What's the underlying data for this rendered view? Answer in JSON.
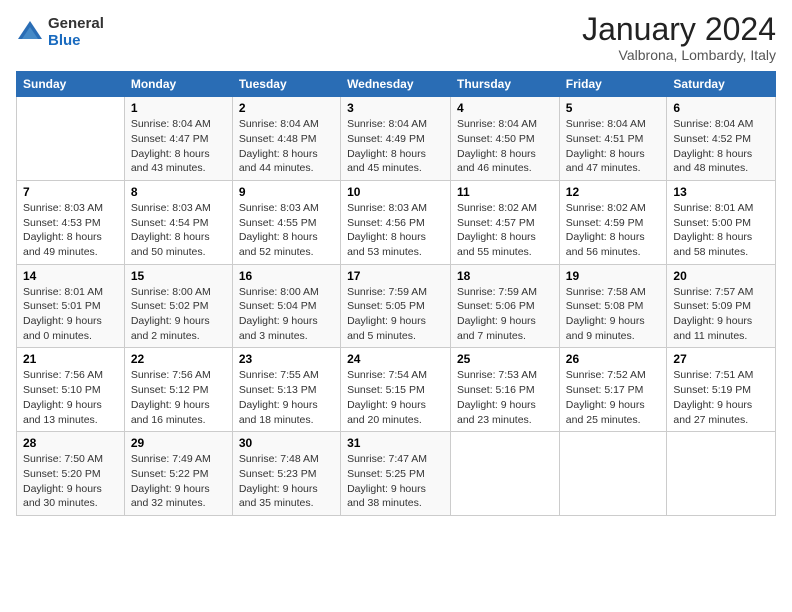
{
  "header": {
    "logo_general": "General",
    "logo_blue": "Blue",
    "month_year": "January 2024",
    "location": "Valbrona, Lombardy, Italy"
  },
  "days_of_week": [
    "Sunday",
    "Monday",
    "Tuesday",
    "Wednesday",
    "Thursday",
    "Friday",
    "Saturday"
  ],
  "weeks": [
    [
      {
        "day": "",
        "sunrise": "",
        "sunset": "",
        "daylight": ""
      },
      {
        "day": "1",
        "sunrise": "Sunrise: 8:04 AM",
        "sunset": "Sunset: 4:47 PM",
        "daylight": "Daylight: 8 hours and 43 minutes."
      },
      {
        "day": "2",
        "sunrise": "Sunrise: 8:04 AM",
        "sunset": "Sunset: 4:48 PM",
        "daylight": "Daylight: 8 hours and 44 minutes."
      },
      {
        "day": "3",
        "sunrise": "Sunrise: 8:04 AM",
        "sunset": "Sunset: 4:49 PM",
        "daylight": "Daylight: 8 hours and 45 minutes."
      },
      {
        "day": "4",
        "sunrise": "Sunrise: 8:04 AM",
        "sunset": "Sunset: 4:50 PM",
        "daylight": "Daylight: 8 hours and 46 minutes."
      },
      {
        "day": "5",
        "sunrise": "Sunrise: 8:04 AM",
        "sunset": "Sunset: 4:51 PM",
        "daylight": "Daylight: 8 hours and 47 minutes."
      },
      {
        "day": "6",
        "sunrise": "Sunrise: 8:04 AM",
        "sunset": "Sunset: 4:52 PM",
        "daylight": "Daylight: 8 hours and 48 minutes."
      }
    ],
    [
      {
        "day": "7",
        "sunrise": "Sunrise: 8:03 AM",
        "sunset": "Sunset: 4:53 PM",
        "daylight": "Daylight: 8 hours and 49 minutes."
      },
      {
        "day": "8",
        "sunrise": "Sunrise: 8:03 AM",
        "sunset": "Sunset: 4:54 PM",
        "daylight": "Daylight: 8 hours and 50 minutes."
      },
      {
        "day": "9",
        "sunrise": "Sunrise: 8:03 AM",
        "sunset": "Sunset: 4:55 PM",
        "daylight": "Daylight: 8 hours and 52 minutes."
      },
      {
        "day": "10",
        "sunrise": "Sunrise: 8:03 AM",
        "sunset": "Sunset: 4:56 PM",
        "daylight": "Daylight: 8 hours and 53 minutes."
      },
      {
        "day": "11",
        "sunrise": "Sunrise: 8:02 AM",
        "sunset": "Sunset: 4:57 PM",
        "daylight": "Daylight: 8 hours and 55 minutes."
      },
      {
        "day": "12",
        "sunrise": "Sunrise: 8:02 AM",
        "sunset": "Sunset: 4:59 PM",
        "daylight": "Daylight: 8 hours and 56 minutes."
      },
      {
        "day": "13",
        "sunrise": "Sunrise: 8:01 AM",
        "sunset": "Sunset: 5:00 PM",
        "daylight": "Daylight: 8 hours and 58 minutes."
      }
    ],
    [
      {
        "day": "14",
        "sunrise": "Sunrise: 8:01 AM",
        "sunset": "Sunset: 5:01 PM",
        "daylight": "Daylight: 9 hours and 0 minutes."
      },
      {
        "day": "15",
        "sunrise": "Sunrise: 8:00 AM",
        "sunset": "Sunset: 5:02 PM",
        "daylight": "Daylight: 9 hours and 2 minutes."
      },
      {
        "day": "16",
        "sunrise": "Sunrise: 8:00 AM",
        "sunset": "Sunset: 5:04 PM",
        "daylight": "Daylight: 9 hours and 3 minutes."
      },
      {
        "day": "17",
        "sunrise": "Sunrise: 7:59 AM",
        "sunset": "Sunset: 5:05 PM",
        "daylight": "Daylight: 9 hours and 5 minutes."
      },
      {
        "day": "18",
        "sunrise": "Sunrise: 7:59 AM",
        "sunset": "Sunset: 5:06 PM",
        "daylight": "Daylight: 9 hours and 7 minutes."
      },
      {
        "day": "19",
        "sunrise": "Sunrise: 7:58 AM",
        "sunset": "Sunset: 5:08 PM",
        "daylight": "Daylight: 9 hours and 9 minutes."
      },
      {
        "day": "20",
        "sunrise": "Sunrise: 7:57 AM",
        "sunset": "Sunset: 5:09 PM",
        "daylight": "Daylight: 9 hours and 11 minutes."
      }
    ],
    [
      {
        "day": "21",
        "sunrise": "Sunrise: 7:56 AM",
        "sunset": "Sunset: 5:10 PM",
        "daylight": "Daylight: 9 hours and 13 minutes."
      },
      {
        "day": "22",
        "sunrise": "Sunrise: 7:56 AM",
        "sunset": "Sunset: 5:12 PM",
        "daylight": "Daylight: 9 hours and 16 minutes."
      },
      {
        "day": "23",
        "sunrise": "Sunrise: 7:55 AM",
        "sunset": "Sunset: 5:13 PM",
        "daylight": "Daylight: 9 hours and 18 minutes."
      },
      {
        "day": "24",
        "sunrise": "Sunrise: 7:54 AM",
        "sunset": "Sunset: 5:15 PM",
        "daylight": "Daylight: 9 hours and 20 minutes."
      },
      {
        "day": "25",
        "sunrise": "Sunrise: 7:53 AM",
        "sunset": "Sunset: 5:16 PM",
        "daylight": "Daylight: 9 hours and 23 minutes."
      },
      {
        "day": "26",
        "sunrise": "Sunrise: 7:52 AM",
        "sunset": "Sunset: 5:17 PM",
        "daylight": "Daylight: 9 hours and 25 minutes."
      },
      {
        "day": "27",
        "sunrise": "Sunrise: 7:51 AM",
        "sunset": "Sunset: 5:19 PM",
        "daylight": "Daylight: 9 hours and 27 minutes."
      }
    ],
    [
      {
        "day": "28",
        "sunrise": "Sunrise: 7:50 AM",
        "sunset": "Sunset: 5:20 PM",
        "daylight": "Daylight: 9 hours and 30 minutes."
      },
      {
        "day": "29",
        "sunrise": "Sunrise: 7:49 AM",
        "sunset": "Sunset: 5:22 PM",
        "daylight": "Daylight: 9 hours and 32 minutes."
      },
      {
        "day": "30",
        "sunrise": "Sunrise: 7:48 AM",
        "sunset": "Sunset: 5:23 PM",
        "daylight": "Daylight: 9 hours and 35 minutes."
      },
      {
        "day": "31",
        "sunrise": "Sunrise: 7:47 AM",
        "sunset": "Sunset: 5:25 PM",
        "daylight": "Daylight: 9 hours and 38 minutes."
      },
      {
        "day": "",
        "sunrise": "",
        "sunset": "",
        "daylight": ""
      },
      {
        "day": "",
        "sunrise": "",
        "sunset": "",
        "daylight": ""
      },
      {
        "day": "",
        "sunrise": "",
        "sunset": "",
        "daylight": ""
      }
    ]
  ]
}
